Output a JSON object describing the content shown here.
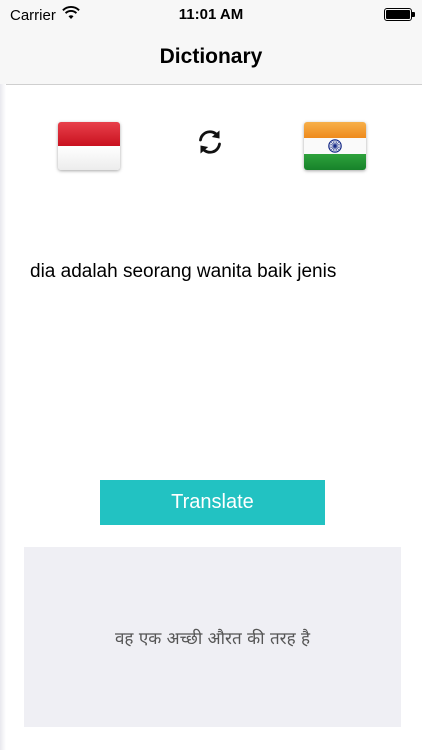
{
  "status_bar": {
    "carrier": "Carrier",
    "time": "11:01 AM",
    "wifi_icon": "wifi-icon",
    "battery_icon": "battery-icon"
  },
  "nav": {
    "title": "Dictionary"
  },
  "languages": {
    "source_flag": "indonesia-flag",
    "target_flag": "india-flag",
    "swap_icon": "swap-arrows-icon",
    "colors": {
      "indonesia_red": "#d9192a",
      "india_saffron": "#f39a2b",
      "india_green": "#1d8f2c",
      "chakra_blue": "#1b2f8a"
    }
  },
  "input": {
    "text": "dia adalah seorang wanita baik jenis"
  },
  "actions": {
    "translate_label": "Translate",
    "accent": "#22c2c2"
  },
  "output": {
    "text": "वह एक अच्छी औरत की तरह है",
    "background": "#efeff4"
  }
}
